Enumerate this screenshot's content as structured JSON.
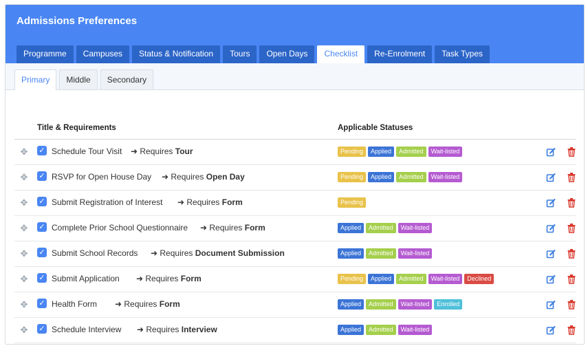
{
  "header": {
    "title": "Admissions Preferences"
  },
  "main_tabs": [
    "Programme",
    "Campuses",
    "Status & Notification",
    "Tours",
    "Open Days",
    "Checklist",
    "Re-Enrolment",
    "Task Types"
  ],
  "sub_tabs": [
    "Primary",
    "Middle",
    "Secondary"
  ],
  "table": {
    "col_title": "Title & Requirements",
    "col_statuses": "Applicable Statuses",
    "rows": [
      {
        "title": "Schedule Tour Visit",
        "req_prefix": "➜ Requires",
        "req": "Tour",
        "statuses": [
          "Pending",
          "Applied",
          "Admitted",
          "Wait-listed"
        ]
      },
      {
        "title": "RSVP for Open House Day",
        "req_prefix": "➜ Requires",
        "req": "Open Day",
        "statuses": [
          "Pending",
          "Applied",
          "Admitted",
          "Wait-listed"
        ]
      },
      {
        "title": "Submit Registration of Interest",
        "req_prefix": "➜ Requires",
        "req": "Form",
        "statuses": [
          "Pending"
        ]
      },
      {
        "title": "Complete Prior School Questionnaire",
        "req_prefix": "➜ Requires",
        "req": "Form",
        "statuses": [
          "Applied",
          "Admitted",
          "Wait-listed"
        ]
      },
      {
        "title": "Submit School Records",
        "req_prefix": "➜ Requires",
        "req": "Document Submission",
        "statuses": [
          "Applied",
          "Admitted",
          "Wait-listed"
        ]
      },
      {
        "title": "Submit Application",
        "req_prefix": "➜ Requires",
        "req": "Form",
        "statuses": [
          "Pending",
          "Applied",
          "Admitted",
          "Wait-listed",
          "Declined"
        ]
      },
      {
        "title": "Health Form",
        "req_prefix": "➜ Requires",
        "req": "Form",
        "statuses": [
          "Applied",
          "Admitted",
          "Wait-listed",
          "Enrolled"
        ]
      },
      {
        "title": "Schedule Interview",
        "req_prefix": "➜ Requires",
        "req": "Interview",
        "statuses": [
          "Applied",
          "Admitted",
          "Wait-listed"
        ]
      }
    ]
  },
  "colors": {
    "header": "#4a86f3",
    "tab": "#2c65c8",
    "pending": "#e8c24a",
    "applied": "#3b74d6",
    "admitted": "#a5cf4c",
    "waitlisted": "#b55bd1",
    "declined": "#d94b43",
    "enrolled": "#4fc0da",
    "edit_icon": "#3a7de0",
    "delete_icon": "#d9382c"
  },
  "icons": {
    "drag": "move-arrows-icon",
    "check": "checkbox-checked-icon",
    "edit": "edit-icon",
    "delete": "trash-icon"
  }
}
